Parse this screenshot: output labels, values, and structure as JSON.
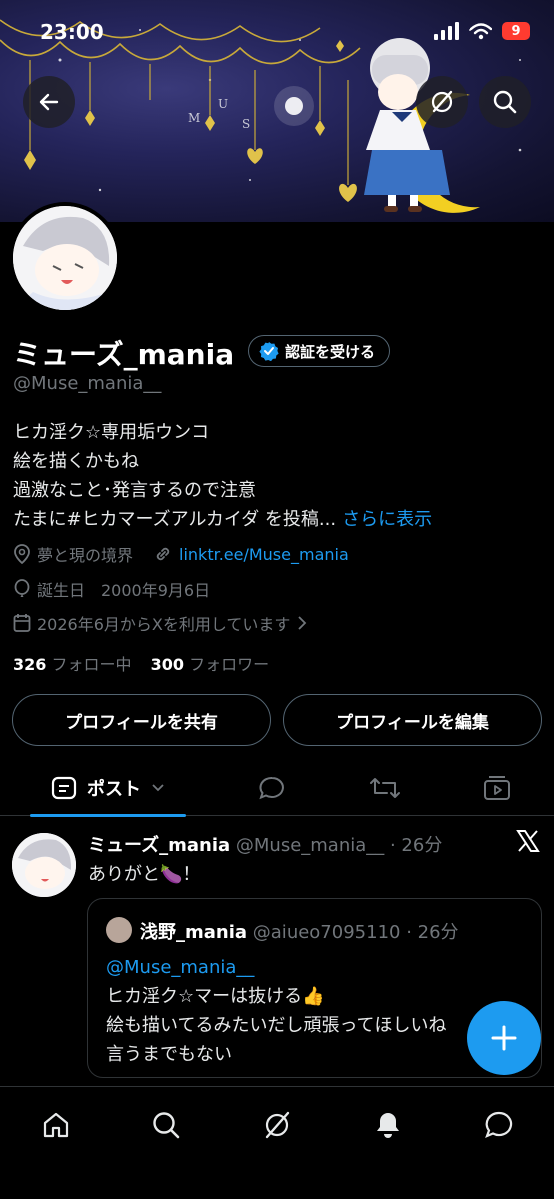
{
  "status": {
    "time": "23:00",
    "battery": "9"
  },
  "profile": {
    "display_name": "ミューズ_mania",
    "verify_label": "認証を受ける",
    "handle": "@Muse_mania__",
    "bio_lines": [
      "ヒカ淫ク☆専用垢ウンコ",
      "絵を描くかもね",
      "過激なこと･発言するので注意",
      "たまに#ヒカマーズアルカイダ を投稿..."
    ],
    "bio_more": "さらに表示",
    "location": "夢と現の境界",
    "link": "linktr.ee/Muse_mania",
    "birthday": "誕生日　2000年9月6日",
    "joined": "2026年6月からXを利用しています",
    "following_count": "326",
    "following_label": "フォロー中",
    "followers_count": "300",
    "followers_label": "フォロワー",
    "share_button": "プロフィールを共有",
    "edit_button": "プロフィールを編集"
  },
  "tabs": {
    "posts_label": "ポスト"
  },
  "post": {
    "name": "ミューズ_mania",
    "meta": "@Muse_mania__ · 26分",
    "text": "ありがと🍆！",
    "quote": {
      "name": "浅野_mania",
      "meta": "@aiueo7095110 · 26分",
      "mention": "@Muse_mania__",
      "lines": [
        "ヒカ淫ク☆マーは抜ける👍",
        "絵も描いてるみたいだし頑張ってほしいね",
        "言うまでもない"
      ]
    }
  },
  "colors": {
    "accent": "#1d9bf0",
    "muted": "#71767b",
    "border": "#2f3336"
  }
}
